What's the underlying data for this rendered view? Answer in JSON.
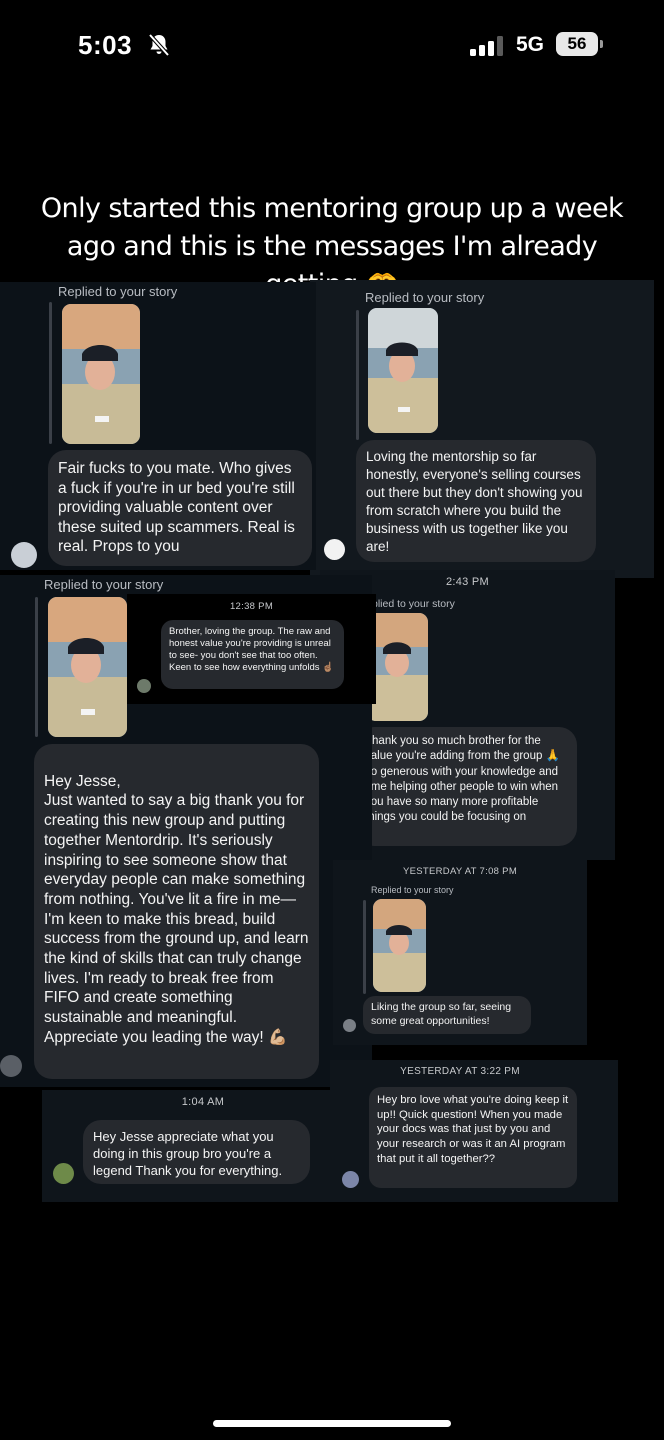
{
  "status_bar": {
    "time": "5:03",
    "network": "5G",
    "battery": "56"
  },
  "caption": {
    "text": "Only started this mentoring group up a week ago and this is the messages I'm already getting",
    "emoji": "🫶"
  },
  "messages": [
    {
      "label": "Replied to your story",
      "text": "Fair fucks to you mate. Who gives a fuck if you're in ur bed you're still providing valuable content over these suited up scammers. Real is real. Props to you"
    },
    {
      "label": "Replied to your story",
      "text": "Loving the mentorship so far honestly, everyone's selling courses out there but they don't showing you from scratch where you build the business with us together like you are!"
    },
    {
      "label": "Replied to your story",
      "text": "Hey Jesse,\nJust wanted to say a big thank you for creating this new group and putting together Mentordrip. It's seriously inspiring to see someone show that everyday people can make something from nothing. You've lit a fire in me—I'm keen to make this bread, build success from the ground up, and learn the kind of skills that can truly change lives. I'm ready to break free from FIFO and create something sustainable and meaningful. Appreciate you leading the way! 💪🏼"
    },
    {
      "timestamp": "12:38 PM",
      "text": "Brother, loving the group. The raw and honest value you're providing is unreal to see- you don't see that too often. Keen to see how everything unfolds ☝🏽"
    },
    {
      "timestamp": "2:43 PM",
      "label": "plied to your story",
      "text": "Thank you so much brother for the value you're adding from the group 🙏 so generous with your knowledge and time helping other people to win when you have so many more profitable things you could be focusing on"
    },
    {
      "timestamp": "YESTERDAY AT 7:08 PM",
      "label": "Replied to your story",
      "text": "Liking the group so far, seeing some great opportunities!"
    },
    {
      "timestamp": "1:04 AM",
      "text": "Hey Jesse appreciate what you doing in this group bro you're a legend Thank you for everything."
    },
    {
      "timestamp": "YESTERDAY AT 3:22 PM",
      "text": "Hey bro love what you're doing keep it up!! Quick question! When you made your docs was that just by you and your research or was it an AI program that put it all together??"
    }
  ]
}
